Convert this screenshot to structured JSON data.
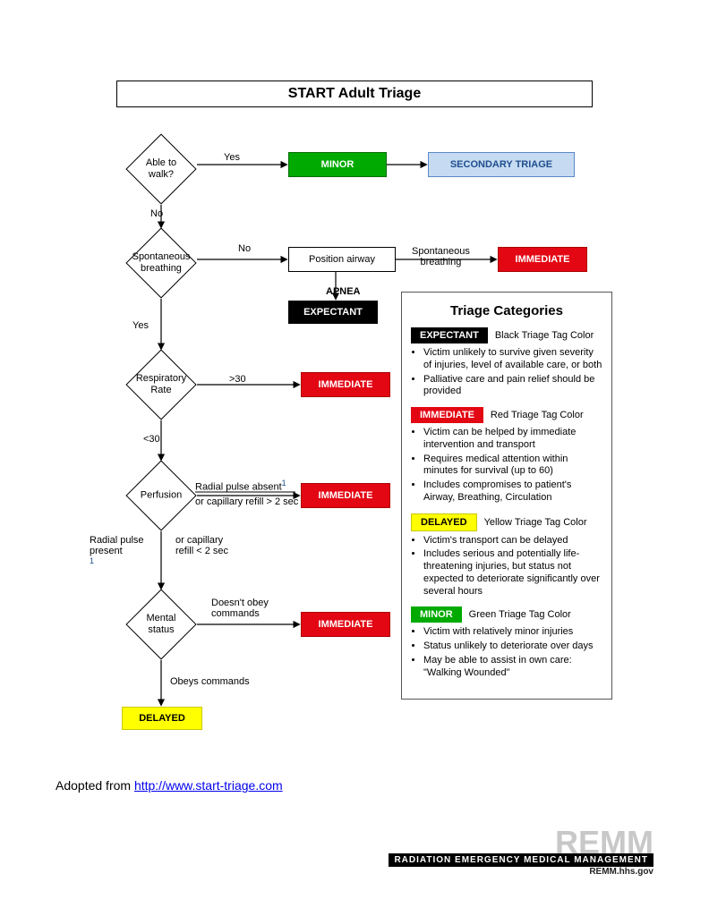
{
  "title": "START Adult Triage",
  "nodes": {
    "able_to_walk": "Able to\nwalk?",
    "minor": "MINOR",
    "secondary": "SECONDARY TRIAGE",
    "spont_breath": "Spontaneous\nbreathing",
    "position_airway": "Position airway",
    "immediate1": "IMMEDIATE",
    "expectant": "EXPECTANT",
    "resp_rate": "Respiratory\nRate",
    "immediate2": "IMMEDIATE",
    "perfusion": "Perfusion",
    "immediate3": "IMMEDIATE",
    "mental": "Mental\nstatus",
    "immediate4": "IMMEDIATE",
    "delayed": "DELAYED"
  },
  "edges": {
    "yes1": "Yes",
    "no1": "No",
    "no2": "No",
    "spont_breath2": "Spontaneous\nbreathing",
    "apnea": "APNEA",
    "yes2": "Yes",
    "gt30": ">30",
    "lt30": "<30",
    "radial_absent": "Radial pulse absent",
    "cap_gt2": "or capillary refill > 2 sec",
    "radial_present": "Radial pulse\npresent",
    "cap_lt2": "or capillary\nrefill < 2 sec",
    "doesnt_obey": "Doesn't obey\ncommands",
    "obeys": "Obeys commands"
  },
  "panel": {
    "title": "Triage Categories",
    "expectant": {
      "tag": "EXPECTANT",
      "color_label": "Black Triage Tag Color",
      "bullets": [
        "Victim unlikely to survive given severity of injuries, level of available care, or both",
        "Palliative care and pain relief should be provided"
      ]
    },
    "immediate": {
      "tag": "IMMEDIATE",
      "color_label": "Red Triage Tag Color",
      "bullets": [
        "Victim can be helped by immediate intervention and transport",
        "Requires medical attention within minutes for survival (up to 60)",
        "Includes compromises to patient's Airway, Breathing, Circulation"
      ]
    },
    "delayed": {
      "tag": "DELAYED",
      "color_label": "Yellow Triage Tag Color",
      "bullets": [
        "Victim's transport can be delayed",
        "Includes serious and potentially life-threatening injuries, but status not expected to deteriorate significantly over several hours"
      ]
    },
    "minor": {
      "tag": "MINOR",
      "color_label": "Green Triage Tag Color",
      "bullets": [
        "Victim with relatively minor injuries",
        "Status unlikely to deteriorate over days",
        "May be able to assist in own care: \"Walking Wounded\""
      ]
    }
  },
  "footer": {
    "adopted_prefix": "Adopted from ",
    "adopted_link": "http://www.start-triage.com",
    "remm_logo": "REMM",
    "remm_bar": "RADIATION EMERGENCY MEDICAL MANAGEMENT",
    "remm_sub": "REMM.hhs.gov"
  }
}
